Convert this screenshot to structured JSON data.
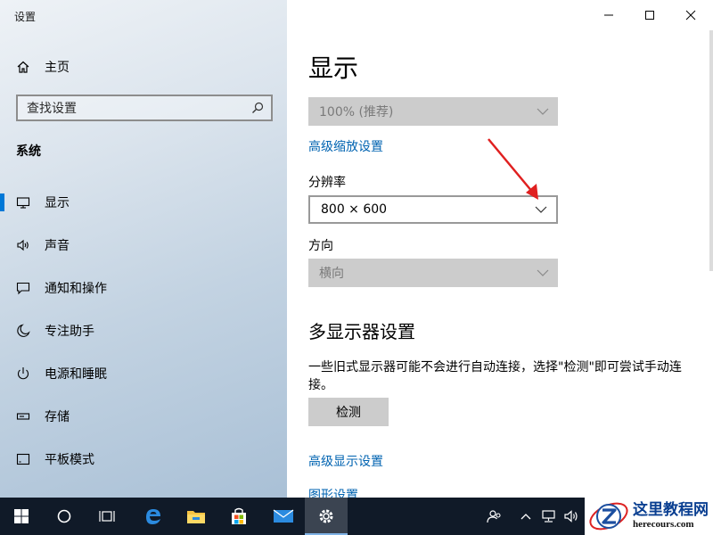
{
  "window": {
    "title": "设置"
  },
  "sidebar": {
    "home_label": "主页",
    "search_placeholder": "查找设置",
    "section": "系统",
    "items": [
      {
        "label": "显示",
        "icon": "monitor-icon",
        "active": true
      },
      {
        "label": "声音",
        "icon": "speaker-icon"
      },
      {
        "label": "通知和操作",
        "icon": "notification-icon"
      },
      {
        "label": "专注助手",
        "icon": "moon-icon"
      },
      {
        "label": "电源和睡眠",
        "icon": "power-icon"
      },
      {
        "label": "存储",
        "icon": "storage-icon"
      },
      {
        "label": "平板模式",
        "icon": "tablet-icon"
      }
    ]
  },
  "main": {
    "title": "显示",
    "scale_value": "100% (推荐)",
    "scale_link": "高级缩放设置",
    "resolution_label": "分辨率",
    "resolution_value": "800 × 600",
    "orientation_label": "方向",
    "orientation_value": "横向",
    "multi_title": "多显示器设置",
    "multi_desc": "一些旧式显示器可能不会进行自动连接，选择\"检测\"即可尝试手动连接。",
    "detect_label": "检测",
    "advanced_link": "高级显示设置",
    "graphics_link": "图形设置"
  },
  "taskbar": {
    "items": [
      "windows-start-icon",
      "cortana-icon",
      "task-view-icon",
      "edge-icon",
      "file-explorer-icon",
      "store-icon",
      "mail-icon",
      "settings-icon"
    ],
    "active": "settings-icon",
    "tray": [
      "people-icon",
      "chevron-up-icon",
      "network-icon",
      "volume-icon"
    ]
  },
  "watermark": {
    "title": "这里教程网",
    "subtitle": "herecours.com"
  },
  "colors": {
    "accent": "#0078d7",
    "link": "#0063b1",
    "taskbar": "#101a28",
    "annotation": "#e02020"
  }
}
